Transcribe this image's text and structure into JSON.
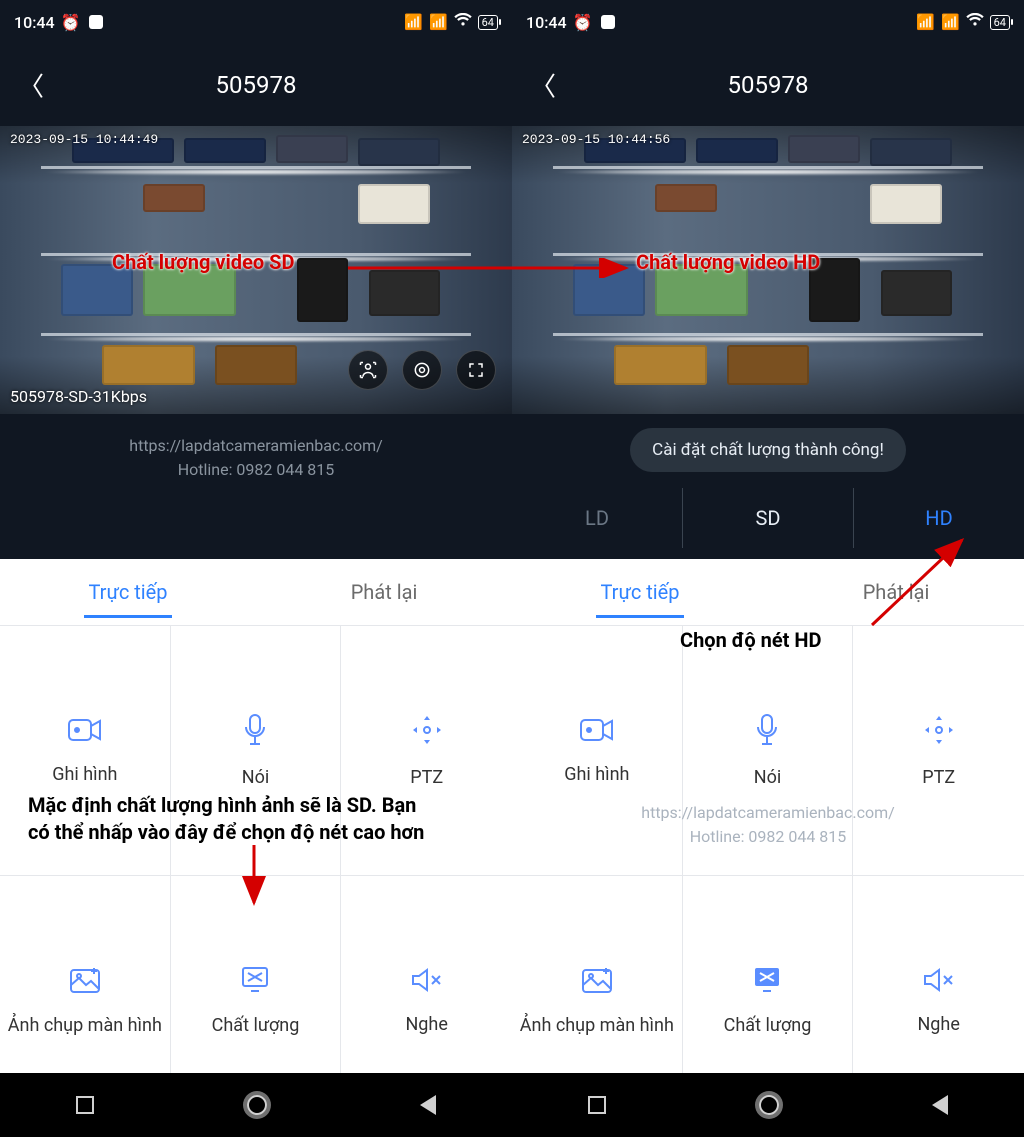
{
  "status": {
    "time": "10:44",
    "battery": "64"
  },
  "title": "505978",
  "video": {
    "timestamp_left": "2023-09-15 10:44:49",
    "timestamp_right": "2023-09-15 10:44:56",
    "info_left": "505978-SD-31Kbps"
  },
  "watermark": {
    "url": "https://lapdatcameramienbac.com/",
    "hotline": "Hotline: 0982 044 815"
  },
  "toast": "Cài đặt chất lượng thành công!",
  "quality": {
    "ld": "LD",
    "sd": "SD",
    "hd": "HD"
  },
  "tabs": {
    "live": "Trực tiếp",
    "playback": "Phát lại"
  },
  "tools": {
    "record": "Ghi hình",
    "talk": "Nói",
    "ptz": "PTZ",
    "screenshot": "Ảnh chụp màn hình",
    "quality": "Chất lượng",
    "listen": "Nghe"
  },
  "annotations": {
    "sd_label": "Chất lượng video SD",
    "hd_label": "Chất lượng video HD",
    "choose_hd": "Chọn độ nét HD",
    "info1": "Mặc định chất lượng hình ảnh sẽ là SD. Bạn",
    "info2": "có thể nhấp vào đây để chọn độ nét cao hơn"
  }
}
